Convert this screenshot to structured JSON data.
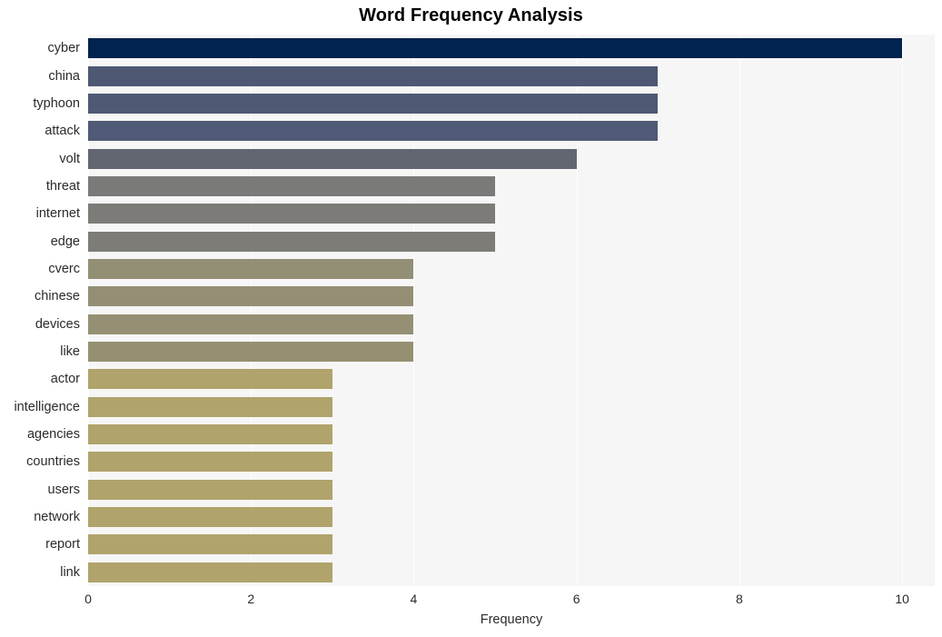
{
  "chart_data": {
    "type": "bar",
    "orientation": "horizontal",
    "title": "Word Frequency Analysis",
    "xlabel": "Frequency",
    "ylabel": "",
    "xlim": [
      0,
      10.4
    ],
    "xticks": [
      0,
      2,
      4,
      6,
      8,
      10
    ],
    "xtick_labels": [
      "0",
      "2",
      "4",
      "6",
      "8",
      "10"
    ],
    "grid": true,
    "grid_axis": "x",
    "legend": false,
    "plot_background": "#f6f6f6",
    "gridline_color": "#ffffff",
    "categories": [
      "cyber",
      "china",
      "typhoon",
      "attack",
      "volt",
      "threat",
      "internet",
      "edge",
      "cverc",
      "chinese",
      "devices",
      "like",
      "actor",
      "intelligence",
      "agencies",
      "countries",
      "users",
      "network",
      "report",
      "link"
    ],
    "values": [
      10,
      7,
      7,
      7,
      6,
      5,
      5,
      5,
      4,
      4,
      4,
      4,
      3,
      3,
      3,
      3,
      3,
      3,
      3,
      3
    ],
    "colors": [
      "#00234f",
      "#4e5873",
      "#4f5974",
      "#505a76",
      "#626670",
      "#7a7a78",
      "#7c7b77",
      "#7d7c77",
      "#938f75",
      "#948f74",
      "#959073",
      "#959072",
      "#b0a36b",
      "#b0a36b",
      "#b0a36b",
      "#b0a36b",
      "#b0a36b",
      "#b0a36b",
      "#b0a36b",
      "#b0a36b"
    ]
  }
}
